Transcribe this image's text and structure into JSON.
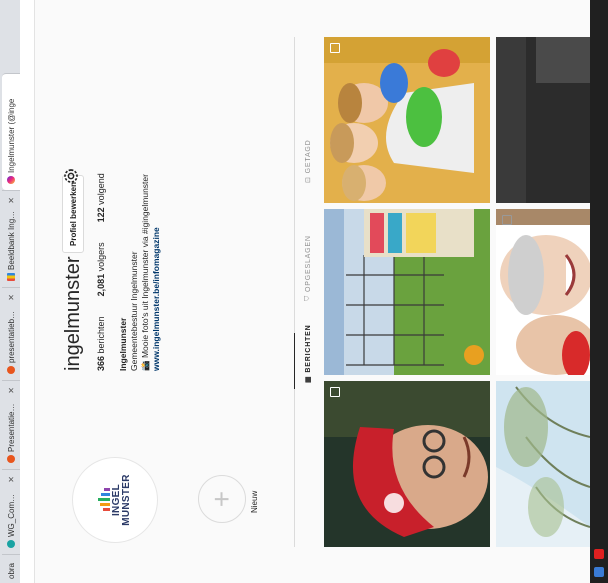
{
  "browser": {
    "tabs": [
      {
        "title": "obra",
        "favicon": "none"
      },
      {
        "title": "WG_Communicatie -",
        "favicon": "teal"
      },
      {
        "title": "Presentatiegemeenten",
        "favicon": "orange"
      },
      {
        "title": "presentatiebeeldban",
        "favicon": "orange"
      },
      {
        "title": "Beeldbank Ingelmunster",
        "favicon": "bars"
      },
      {
        "title": "Ingelmunster (@inge",
        "favicon": "insta",
        "active": true
      }
    ],
    "close_glyph": "✕"
  },
  "profile": {
    "username": "ingelmunster",
    "edit_label": "Profiel bewerken",
    "stats": {
      "posts_count": "366",
      "posts_label": "berichten",
      "followers_count": "2,081",
      "followers_label": "volgers",
      "following_count": "122",
      "following_label": "volgend"
    },
    "bio": {
      "name": "Ingelmunster",
      "line1": "Gemeentebestuur Ingelmunster",
      "line2": "Mooie foto's uit Ingelmunster via #igingelmunster",
      "link": "www.ingelmunster.be/infomagazine"
    },
    "avatar_logo": {
      "line1": "INGEL",
      "line2": "MUNSTER",
      "bar_colors": [
        "#e74c3c",
        "#f39c12",
        "#27ae60",
        "#2e86de",
        "#8e44ad"
      ]
    }
  },
  "highlights": {
    "new_label": "Nieuw",
    "plus_glyph": "+"
  },
  "profile_tabs": [
    {
      "label": "BERICHTEN",
      "icon": "grid-icon",
      "active": true
    },
    {
      "label": "OPGESLAGEN",
      "icon": "bookmark-icon",
      "active": false
    },
    {
      "label": "GETAGD",
      "icon": "tag-icon",
      "active": false
    }
  ],
  "colors": {
    "text": "#262626",
    "muted": "#8e8e8e",
    "link": "#00376b",
    "border": "#dbdbdb",
    "taskbar": "#202020"
  }
}
